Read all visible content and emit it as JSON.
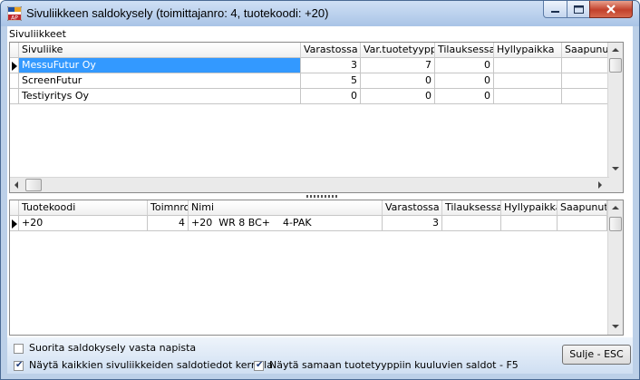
{
  "window": {
    "title": "Sivuliikkeen saldokysely (toimittajanro: 4, tuotekoodi: +20)",
    "app_icon": "AP-icon"
  },
  "branches": {
    "section_label": "Sivuliikkeet",
    "columns": [
      "Sivuliike",
      "Varastossa",
      "Var.tuotetyyppi",
      "Tilauksessa",
      "Hyllypaikka",
      "Saapunut"
    ],
    "rows": [
      {
        "name": "MessuFutur Oy",
        "varastossa": "3",
        "var_tuotetyyppi": "7",
        "tilauksessa": "0",
        "hyllypaikka": "",
        "saapunut": ""
      },
      {
        "name": "ScreenFutur",
        "varastossa": "5",
        "var_tuotetyyppi": "0",
        "tilauksessa": "0",
        "hyllypaikka": "",
        "saapunut": ""
      },
      {
        "name": "Testiyritys Oy",
        "varastossa": "0",
        "var_tuotetyyppi": "0",
        "tilauksessa": "0",
        "hyllypaikka": "",
        "saapunut": ""
      }
    ]
  },
  "products": {
    "columns": [
      "Tuotekoodi",
      "Toimnro",
      "Nimi",
      "Varastossa",
      "Tilauksessa",
      "Hyllypaikka",
      "Saapunut"
    ],
    "rows": [
      {
        "tuotekoodi": "+20",
        "toimnro": "4",
        "nimi": "+20  WR 8 BC+    4-PAK",
        "varastossa": "3",
        "tilauksessa": "",
        "hyllypaikka": "",
        "saapunut": ""
      }
    ]
  },
  "options": {
    "query_on_button": {
      "label": "Suorita saldokysely vasta napista",
      "checked": false
    },
    "show_all_branches": {
      "label": "Näytä kaikkien sivuliikkeiden saldotiedot kerralla",
      "checked": true
    },
    "show_same_type": {
      "label": "Näytä samaan tuotetyyppiin kuuluvien saldot - F5",
      "checked": true
    }
  },
  "close_button": {
    "label": "Sulje - ESC"
  },
  "colors": {
    "selection": "#3399ff",
    "window_frame": "#bcd0e8",
    "close_red": "#c2412c"
  }
}
